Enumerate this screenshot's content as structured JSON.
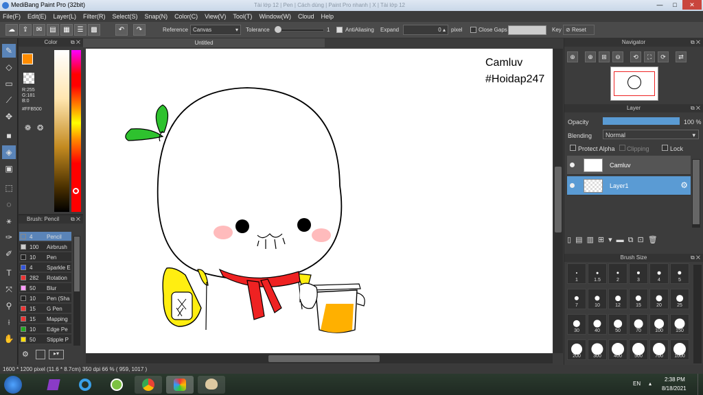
{
  "app": {
    "title": "MediBang Paint Pro (32bit)",
    "ghost_tabs": "Tài lớp 12 | Pen | Cách dùng | Paint Pro nhanh | X | Tài lớp 12",
    "min": "—",
    "max": "□",
    "close": "✕"
  },
  "menu": [
    "File(F)",
    "Edit(E)",
    "Layer(L)",
    "Filter(R)",
    "Select(S)",
    "Snap(N)",
    "Color(C)",
    "View(V)",
    "Tool(T)",
    "Window(W)",
    "Cloud",
    "Help"
  ],
  "toolbar": {
    "reference_label": "Reference",
    "reference_value": "Canvas",
    "tolerance_label": "Tolerance",
    "tolerance_value": "1",
    "antialiasing_label": "AntiAliasing",
    "expand_label": "Expand",
    "expand_value": "0",
    "expand_unit": "pixel",
    "close_gaps_label": "Close Gaps",
    "key_label": "Key",
    "reset_label": "Reset"
  },
  "color_panel": {
    "title": "Color",
    "r": "R:255",
    "g": "G:181",
    "b": "B:0",
    "hex": "#FFB500",
    "fg_color": "#ff8c00"
  },
  "brush_panel": {
    "title": "Brush: Pencil",
    "items": [
      {
        "size": "4",
        "name": "Pencil",
        "color": "#5a84b8"
      },
      {
        "size": "100",
        "name": "Airbrush",
        "color": "#cccccc"
      },
      {
        "size": "10",
        "name": "Pen",
        "color": "#222222"
      },
      {
        "size": "4",
        "name": "Sparkle E",
        "color": "#3355dd"
      },
      {
        "size": "282",
        "name": "Rotation",
        "color": "#ee3333"
      },
      {
        "size": "50",
        "name": "Blur",
        "color": "#ff99ff"
      },
      {
        "size": "10",
        "name": "Pen (Sha",
        "color": "#222222"
      },
      {
        "size": "15",
        "name": "G Pen",
        "color": "#ee3333"
      },
      {
        "size": "15",
        "name": "Mapping",
        "color": "#ee3333"
      },
      {
        "size": "10",
        "name": "Edge Pe",
        "color": "#22aa22"
      },
      {
        "size": "50",
        "name": "Stipple P",
        "color": "#ffdd00"
      }
    ]
  },
  "document": {
    "tab": "Untitled",
    "text_line1": "Camluv",
    "text_line2": "#Hoidap247"
  },
  "navigator": {
    "title": "Navigator"
  },
  "layer_panel": {
    "title": "Layer",
    "opacity_label": "Opacity",
    "opacity_value": "100 %",
    "opacity_fraction": 1.0,
    "blending_label": "Blending",
    "blending_value": "Normal",
    "protect_alpha": "Protect Alpha",
    "clipping": "Clipping",
    "lock": "Lock",
    "layers": [
      {
        "name": "Camluv",
        "selected": false
      },
      {
        "name": "Layer1",
        "selected": true
      }
    ]
  },
  "brush_size_panel": {
    "title": "Brush Size",
    "sizes": [
      "1",
      "1.5",
      "2",
      "3",
      "4",
      "5",
      "7",
      "10",
      "12",
      "15",
      "20",
      "25",
      "30",
      "40",
      "50",
      "70",
      "100",
      "150",
      "200",
      "300",
      "400",
      "500",
      "700",
      "1000"
    ]
  },
  "status": {
    "text": "1600 * 1200 pixel   (11.6 * 8.7cm)   350 dpi   66 %   ( 959, 1017 )"
  },
  "taskbar": {
    "lang": "EN",
    "time": "2:38 PM",
    "date": "8/18/2021"
  }
}
